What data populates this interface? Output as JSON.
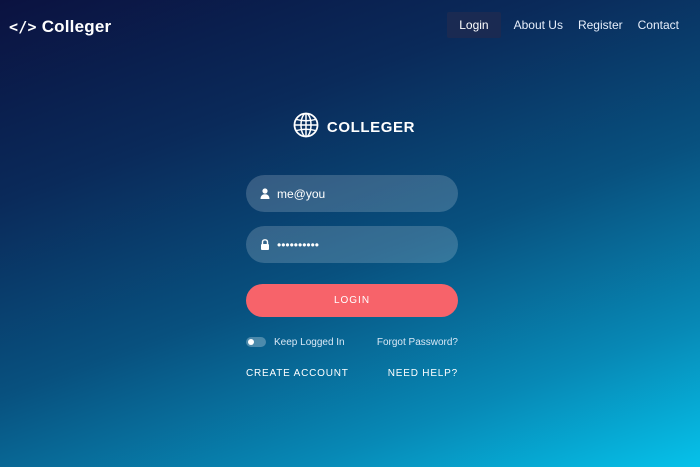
{
  "header": {
    "brand_icon": "</>",
    "brand_name": "Colleger",
    "nav": {
      "login": "Login",
      "about": "About Us",
      "register": "Register",
      "contact": "Contact"
    }
  },
  "form": {
    "logo_text": "COLLEGER",
    "logo_icon": "globe-icon",
    "username_value": "me@you",
    "password_value": "••••••••••",
    "login_button": "LOGIN",
    "keep_logged_in": "Keep Logged In",
    "forgot_password": "Forgot Password?",
    "create_account": "CREATE ACCOUNT",
    "need_help": "NEED HELP?"
  },
  "colors": {
    "login_button": "#f7636a",
    "gradient_start": "#0b1240",
    "gradient_end": "#06c2ea"
  }
}
